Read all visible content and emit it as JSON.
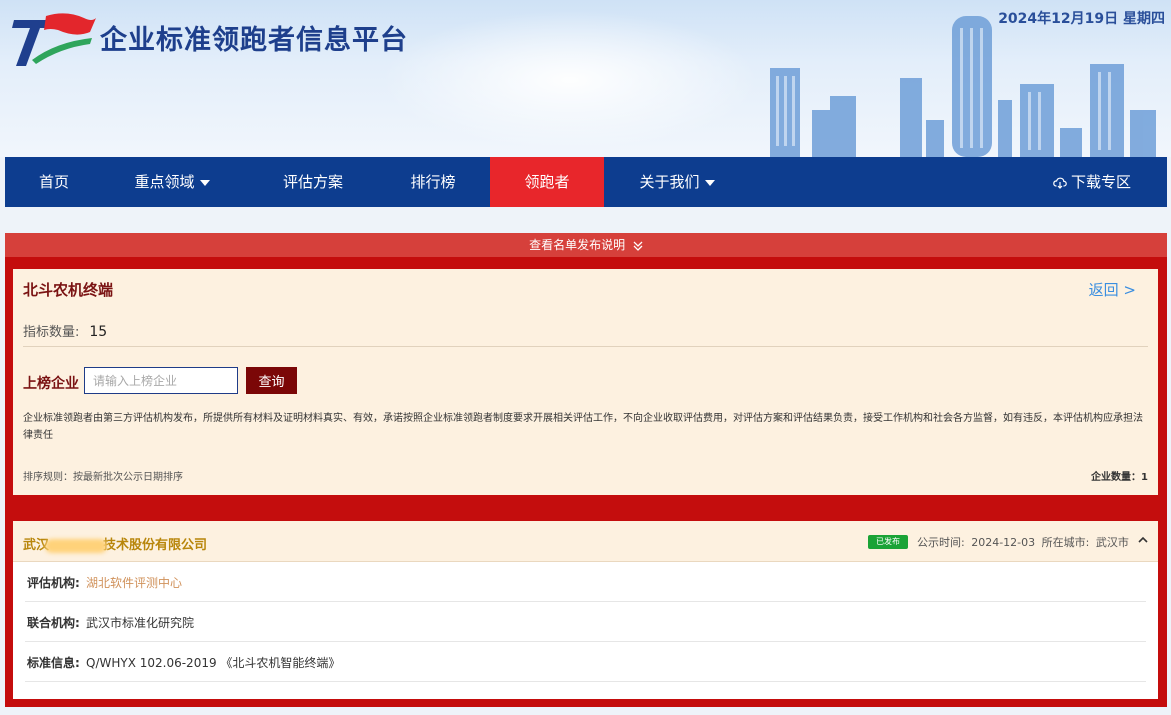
{
  "header": {
    "site_title": "企业标准领跑者信息平台",
    "date_text": "2024年12月19日 星期四"
  },
  "nav": {
    "items": [
      {
        "label": "首页",
        "has_dropdown": false
      },
      {
        "label": "重点领域",
        "has_dropdown": true
      },
      {
        "label": "评估方案",
        "has_dropdown": false
      },
      {
        "label": "排行榜",
        "has_dropdown": false
      },
      {
        "label": "领跑者",
        "has_dropdown": false,
        "active": true
      },
      {
        "label": "关于我们",
        "has_dropdown": true
      }
    ],
    "download": {
      "label": "下载专区",
      "icon": "cloud-download-icon"
    }
  },
  "notice": {
    "label": "查看名单发布说明",
    "icon": "double-chevron-down-icon"
  },
  "product": {
    "title": "北斗农机终端",
    "back_label": "返回 >",
    "metric_label": "指标数量:",
    "metric_value": "15"
  },
  "search": {
    "label": "上榜企业",
    "placeholder": "请输入上榜企业",
    "value": "",
    "button_label": "查询"
  },
  "disclaimer": "企业标准领跑者由第三方评估机构发布，所提供所有材料及证明材料真实、有效，承诺按照企业标准领跑者制度要求开展相关评估工作，不向企业收取评估费用，对评估方案和评估结果负责，接受工作机构和社会各方监督，如有违反，本评估机构应承担法律责任",
  "list_meta": {
    "sort_rule": "排序规则：按最新批次公示日期排序",
    "count_text": "企业数量：1"
  },
  "entry": {
    "company_prefix": "武汉",
    "company_suffix": "技术股份有限公司",
    "badge": "已发布",
    "publish_label": "公示时间:",
    "publish_date": "2024-12-03",
    "city_label": "所在城市:",
    "city": "武汉市",
    "rows": [
      {
        "label": "评估机构:",
        "value": "湖北软件评测中心"
      },
      {
        "label": "联合机构:",
        "value": "武汉市标准化研究院"
      },
      {
        "label": "标准信息:",
        "value": "Q/WHYX 102.06-2019 《北斗农机智能终端》"
      }
    ]
  },
  "colors": {
    "nav_bg": "#0d3d8f",
    "nav_active": "#e8262b",
    "frame_red": "#c40d0d",
    "panel_bg": "#fdf1e0",
    "accent_dark_red": "#7b0707",
    "badge_green": "#1aa336",
    "link_blue": "#3a8ee0"
  }
}
